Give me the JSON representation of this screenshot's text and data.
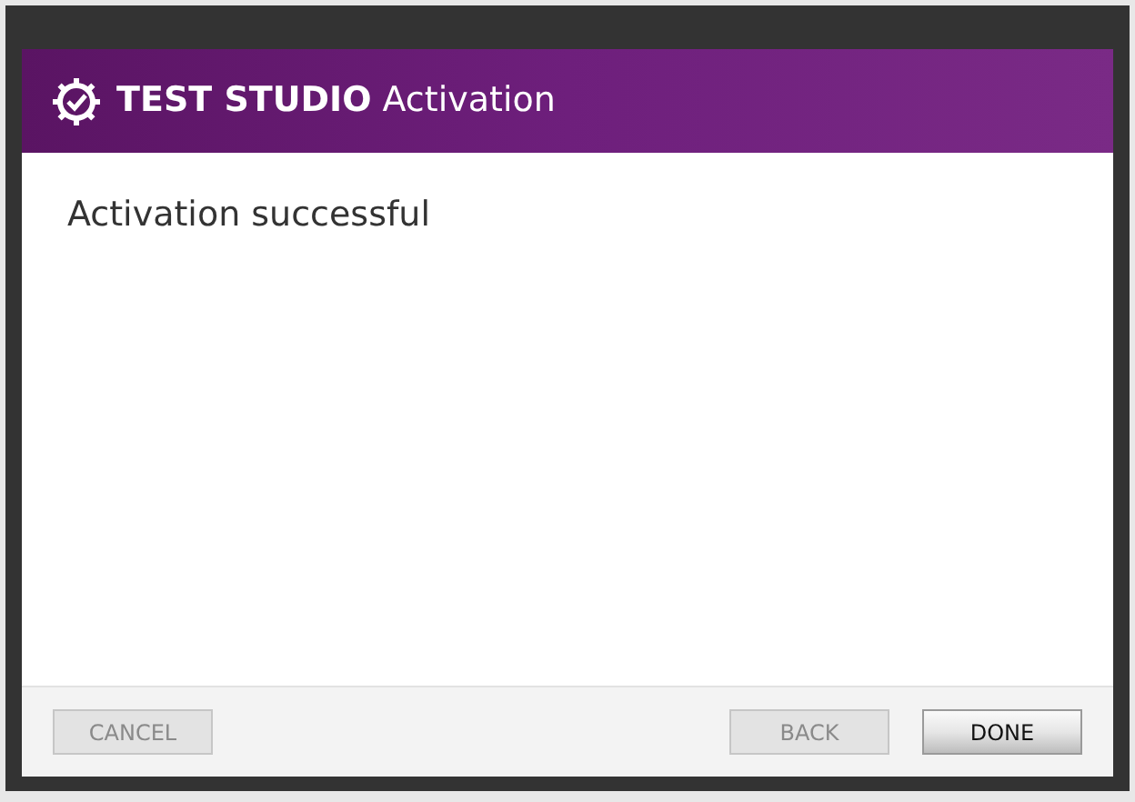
{
  "header": {
    "brand": "TEST STUDIO",
    "title": "Activation"
  },
  "message": "Activation successful",
  "buttons": [
    {
      "label": "CANCEL",
      "disabled": true
    },
    {
      "label": "BACK",
      "disabled": true
    },
    {
      "label": "DONE",
      "disabled": false
    }
  ]
}
